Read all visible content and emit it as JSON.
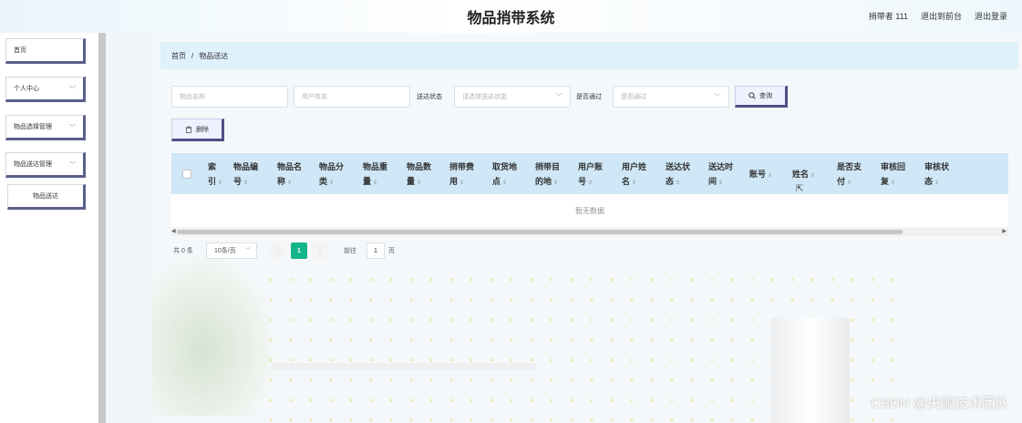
{
  "header": {
    "title": "物品捎带系统",
    "user_label": "捎带者 111",
    "back_to_front": "退出到前台",
    "logout": "退出登录"
  },
  "sidebar": {
    "items": [
      {
        "label": "首页",
        "has_chevron": false
      },
      {
        "label": "个人中心",
        "has_chevron": true
      },
      {
        "label": "物品选择管理",
        "has_chevron": true
      },
      {
        "label": "物品送达管理",
        "has_chevron": true
      }
    ],
    "sub_item": "物品送达",
    "chevron_icon": "chevron-down-icon"
  },
  "breadcrumb": {
    "home": "首页",
    "separator": "/",
    "current": "物品送达"
  },
  "filters": {
    "item_name_placeholder": "物品名称",
    "username_placeholder": "用户姓名",
    "delivery_status_label": "送达状态",
    "delivery_status_placeholder": "请选择送达状态",
    "passed_label": "是否通过",
    "passed_placeholder": "是否通过",
    "query_button": "查询",
    "search_icon": "search-icon"
  },
  "actions": {
    "delete_button": "删除",
    "delete_icon": "trash-icon"
  },
  "table": {
    "columns": [
      {
        "label": "索\n引"
      },
      {
        "label": "物品编\n号"
      },
      {
        "label": "物品名\n称"
      },
      {
        "label": "物品分\n类"
      },
      {
        "label": "物品重\n量"
      },
      {
        "label": "物品数\n量"
      },
      {
        "label": "捎带费\n用"
      },
      {
        "label": "取货地\n点"
      },
      {
        "label": "捎带目\n的地"
      },
      {
        "label": "用户账\n号"
      },
      {
        "label": "用户姓\n名"
      },
      {
        "label": "送达状\n态"
      },
      {
        "label": "送达时\n间"
      },
      {
        "label": "账号"
      },
      {
        "label": "姓名"
      },
      {
        "label": "是否支\n付"
      },
      {
        "label": "审核回\n复"
      },
      {
        "label": "审核状\n态"
      }
    ],
    "empty_text": "暂无数据",
    "sort_icon": "sort-caret-icon"
  },
  "pagination": {
    "total": "共 0 条",
    "page_size": "10条/页",
    "current_page": "1",
    "goto_label": "前往",
    "goto_value": "1",
    "page_suffix": "页",
    "prev_icon": "chevron-left-icon",
    "next_icon": "chevron-right-icon"
  },
  "watermark": "CSDN @央顺技术团队",
  "colors": {
    "accent_green": "#13b58a",
    "breadcrumb_bg": "#dff1fb",
    "table_head_bg": "#cfe7f6",
    "button_border": "#4d5085"
  }
}
